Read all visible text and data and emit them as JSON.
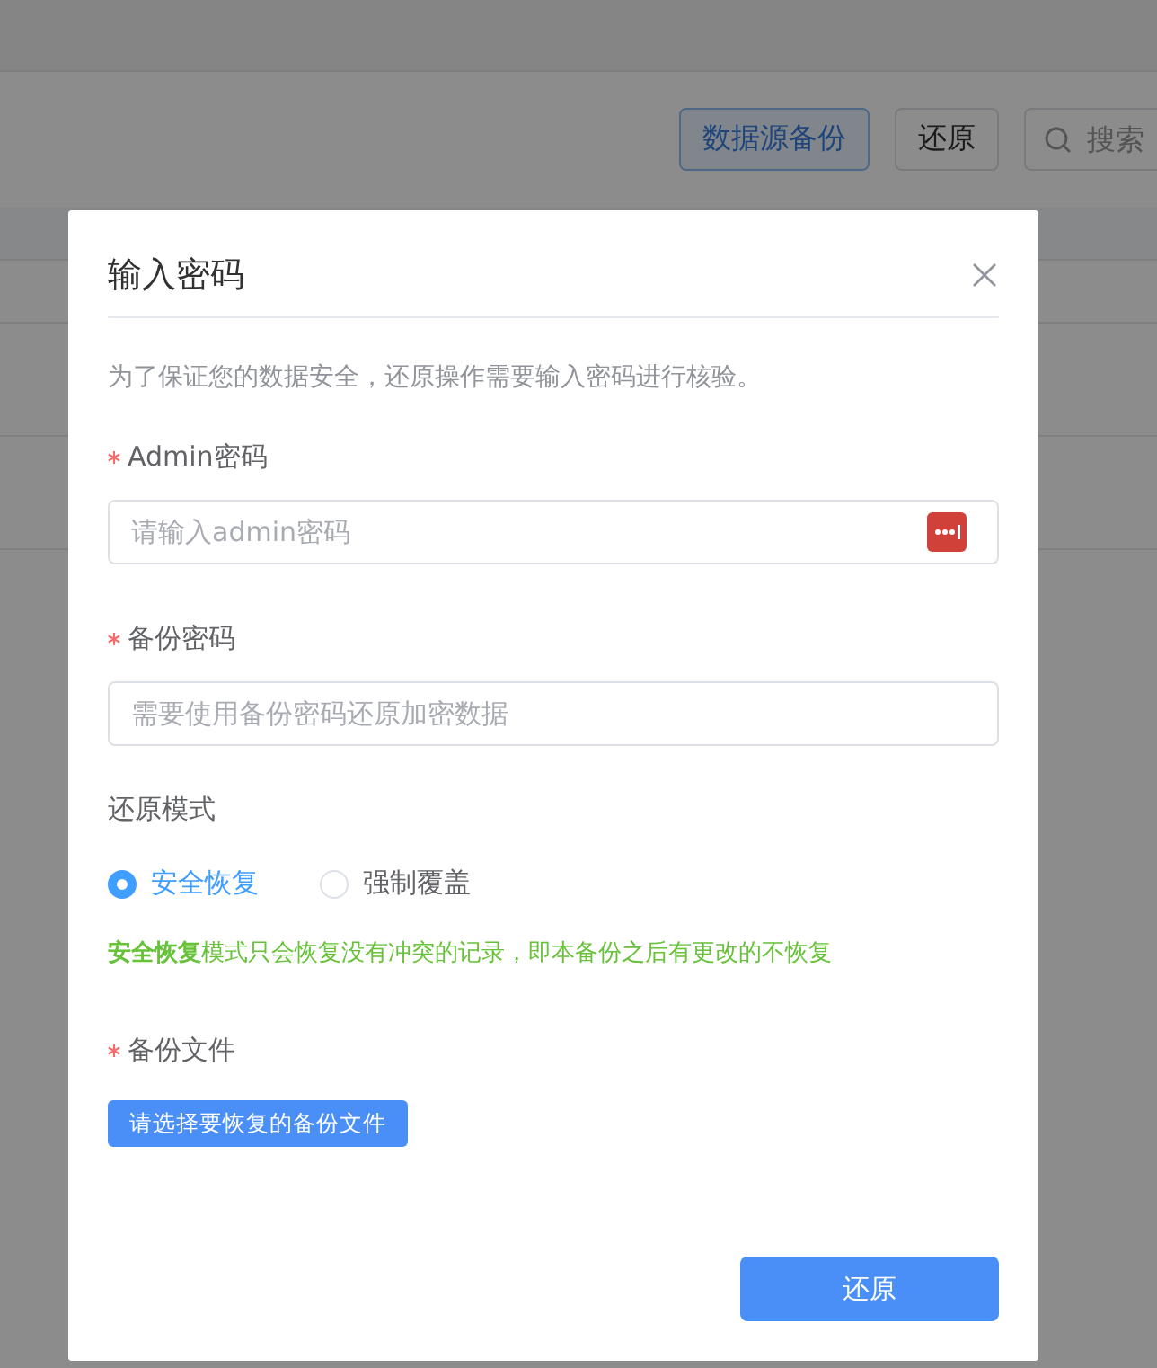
{
  "toolbar": {
    "buttons": [
      {
        "label": "数据源备份",
        "kind": "primary"
      },
      {
        "label": "还原",
        "kind": "plain"
      }
    ],
    "search": {
      "placeholder": "搜索"
    }
  },
  "dialog": {
    "title": "输入密码",
    "description": "为了保证您的数据安全，还原操作需要输入密码进行核验。",
    "fields": [
      {
        "label": "Admin密码",
        "required": true,
        "placeholder": "请输入admin密码",
        "kind": "password"
      },
      {
        "label": "备份密码",
        "required": true,
        "placeholder": "需要使用备份密码还原加密数据",
        "kind": "text"
      }
    ],
    "mode": {
      "label": "还原模式",
      "options": [
        {
          "label": "安全恢复",
          "selected": true
        },
        {
          "label": "强制覆盖",
          "selected": false
        }
      ],
      "hint": "**安全恢复**模式只会恢复没有冲突的记录，即本备份之后有更改的不恢复"
    },
    "file": {
      "label": "备份文件",
      "required": true,
      "button": "请选择要恢复的备份文件"
    },
    "submit": "还原"
  }
}
